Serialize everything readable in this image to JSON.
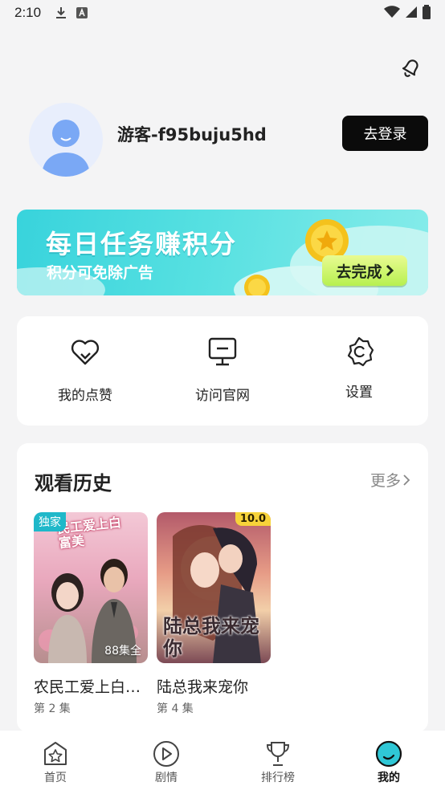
{
  "status_bar": {
    "time": "2:10"
  },
  "profile": {
    "username": "游客-f95buju5hd",
    "login_label": "去登录"
  },
  "banner": {
    "title": "每日任务赚积分",
    "subtitle": "积分可免除广告",
    "cta_label": "去完成"
  },
  "actions": [
    {
      "label": "我的点赞",
      "icon": "heart-icon"
    },
    {
      "label": "访问官网",
      "icon": "monitor-icon"
    },
    {
      "label": "设置",
      "icon": "settings-icon"
    }
  ],
  "history": {
    "title": "观看历史",
    "more_label": "更多",
    "items": [
      {
        "title": "农民工爱上白…",
        "episode": "第 2 集",
        "badge": "独家",
        "episodes_total": "88集全",
        "poster_text": "民工爱上白富美"
      },
      {
        "title": "陆总我来宠你",
        "episode": "第 4 集",
        "score": "10.0",
        "poster_text": "陆总我来宠你"
      }
    ]
  },
  "nav": {
    "items": [
      {
        "label": "首页",
        "icon": "home-star-icon"
      },
      {
        "label": "剧情",
        "icon": "play-icon"
      },
      {
        "label": "排行榜",
        "icon": "trophy-icon"
      },
      {
        "label": "我的",
        "icon": "profile-icon"
      }
    ],
    "active_index": 3
  },
  "colors": {
    "accent": "#1fb8c9",
    "banner_start": "#38d3dc",
    "login_button": "#0b0b0b",
    "score_badge": "#f7d33a"
  }
}
